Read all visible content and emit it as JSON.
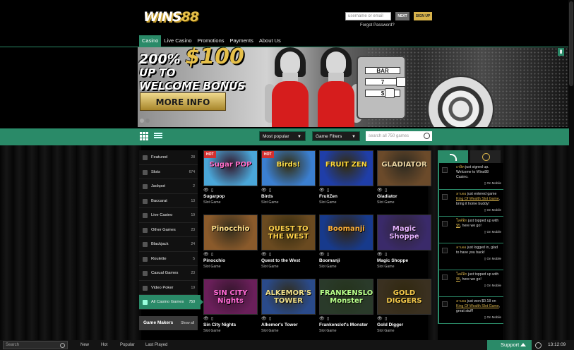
{
  "header": {
    "logo_main": "WINS",
    "logo_num": "88",
    "username_placeholder": "username or email",
    "next_label": "NEXT",
    "signup_label": "SIGN UP",
    "forgot_label": "Forgot Password?"
  },
  "nav": [
    "Casino",
    "Live Casino",
    "Promotions",
    "Payments",
    "About Us"
  ],
  "banner": {
    "line1_prefix": "200%",
    "line1_big": "$100",
    "line2": "UP TO",
    "line3": "WELCOME BONUS",
    "button": "MORE INFO"
  },
  "toolbar": {
    "sort": "Most popular",
    "filter": "Game Filters",
    "search_placeholder": "search all 750 games"
  },
  "sidebar": [
    {
      "label": "Featured",
      "count": "28"
    },
    {
      "label": "Slots",
      "count": "674"
    },
    {
      "label": "Jackpot",
      "count": "2"
    },
    {
      "label": "Baccarat",
      "count": "13"
    },
    {
      "label": "Live Casino",
      "count": "19"
    },
    {
      "label": "Other Games",
      "count": "23"
    },
    {
      "label": "Blackjack",
      "count": "24"
    },
    {
      "label": "Roulette",
      "count": "5"
    },
    {
      "label": "Casual Games",
      "count": "23"
    },
    {
      "label": "Video Poker",
      "count": "19"
    },
    {
      "label": "All Casino Games",
      "count": "750"
    }
  ],
  "game_makers": {
    "title": "Game Makers",
    "show_all": "Show all"
  },
  "games": [
    {
      "name": "Sugarpop",
      "type": "Slot Game",
      "art": "Sugar POP",
      "hot": "HOT",
      "bg": "#4aa6d8",
      "fg": "#ff6ec7"
    },
    {
      "name": "Birds",
      "type": "Slot Game",
      "art": "Birds!",
      "hot": "HOT",
      "bg": "#3b7fd0",
      "fg": "#ffe04a"
    },
    {
      "name": "FruitZen",
      "type": "Slot Game",
      "art": "FRUIT ZEN",
      "hot": "",
      "bg": "#1f3ea8",
      "fg": "#ffd93b"
    },
    {
      "name": "Gladiator",
      "type": "Slot Game",
      "art": "GLADIATOR",
      "hot": "",
      "bg": "#6b4a2a",
      "fg": "#e8d2a0"
    },
    {
      "name": "Pinocchio",
      "type": "Slot Game",
      "art": "Pinocchio",
      "hot": "",
      "bg": "#8a5a2b",
      "fg": "#ffe08a"
    },
    {
      "name": "Quest to the West",
      "type": "Slot Game",
      "art": "QUEST TO THE WEST",
      "hot": "",
      "bg": "#6a4a20",
      "fg": "#ffd24a"
    },
    {
      "name": "Boomanji",
      "type": "Slot Game",
      "art": "Boomanji",
      "hot": "",
      "bg": "#173a8c",
      "fg": "#ffb23a"
    },
    {
      "name": "Magic Shoppe",
      "type": "Slot Game",
      "art": "Magic Shoppe",
      "hot": "",
      "bg": "#3a2a6a",
      "fg": "#e6b3ff"
    },
    {
      "name": "Sin City Nights",
      "type": "Slot Game",
      "art": "SIN CITY Nights",
      "hot": "",
      "bg": "#6a1f5a",
      "fg": "#ff6ad5"
    },
    {
      "name": "Alkemor's Tower",
      "type": "Slot Game",
      "art": "ALKEMOR'S TOWER",
      "hot": "",
      "bg": "#2a4a8a",
      "fg": "#f0e08a"
    },
    {
      "name": "Frankenslot's Monster",
      "type": "Slot Game",
      "art": "FRANKENSLOT'S Monster",
      "hot": "",
      "bg": "#2a3a2a",
      "fg": "#b8ff8a"
    },
    {
      "name": "Gold Digger",
      "type": "Slot Game",
      "art": "GOLD DIGGERS",
      "hot": "",
      "bg": "#3a3020",
      "fg": "#f3c84a"
    }
  ],
  "activity": [
    {
      "user": "เกษิต",
      "pre": " just signed up. Welcome to Wins88 Casino.",
      "link": "",
      "post": "",
      "mobile": "On Mobile"
    },
    {
      "user": "ลาเดอ",
      "pre": " just entered game ",
      "link": "King Of Wealth Slot Game",
      "post": ", bring it home buddy!",
      "mobile": "On Mobile"
    },
    {
      "user": "โสดัอิก",
      "pre": " just topped up with ",
      "link": "$5",
      "post": ", here we go!",
      "mobile": "On Mobile"
    },
    {
      "user": "ลาเดอ",
      "pre": " just logged in, glad to have you back!",
      "link": "",
      "post": "",
      "mobile": "On Mobile"
    },
    {
      "user": "โสดัอิก",
      "pre": " just topped up with ",
      "link": "$5",
      "post": ", here we go!",
      "mobile": "On Mobile"
    },
    {
      "user": "ลาเดอ",
      "pre": " just won $0.18 on ",
      "link": "King Of Wealth Slot Game",
      "post": ", great stuff!",
      "mobile": "On Mobile"
    }
  ],
  "bottom": {
    "search_placeholder": "Search",
    "tabs": [
      "New",
      "Hot",
      "Popular",
      "Last Played"
    ],
    "support": "Support",
    "time": "13:12:09"
  },
  "colors": {
    "accent": "#2a8a68",
    "gold": "#d7b24a",
    "hot": "#d23030"
  }
}
